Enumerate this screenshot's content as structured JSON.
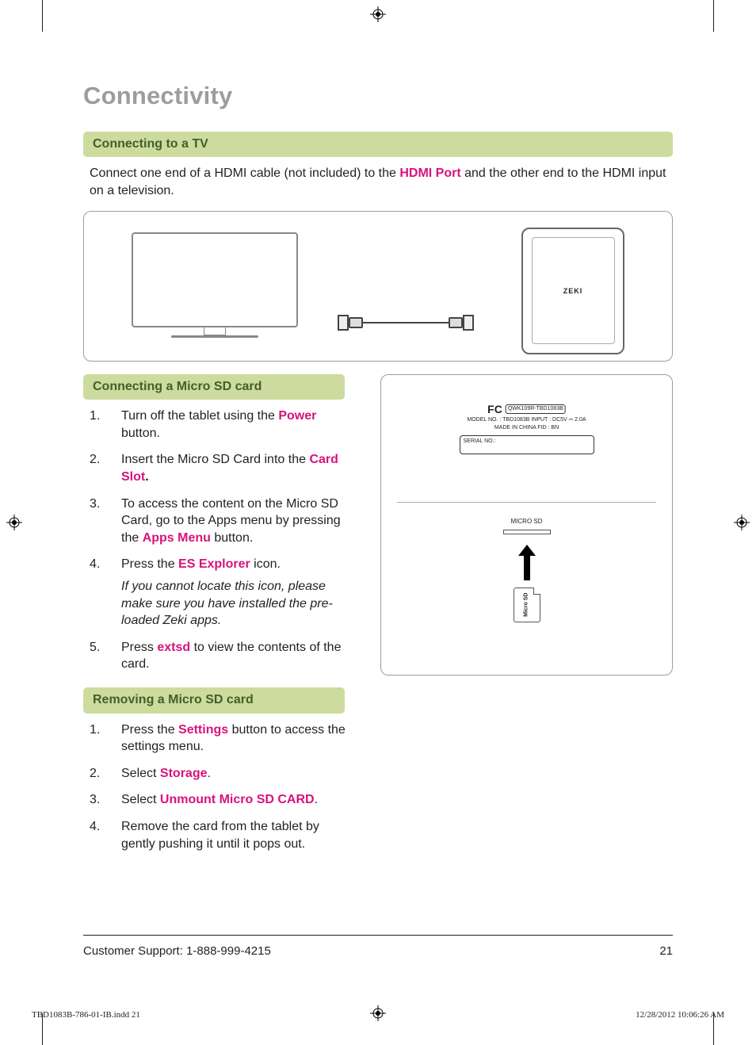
{
  "title": "Connectivity",
  "section_tv": {
    "heading": "Connecting to a TV",
    "text_pre": "Connect one end of a HDMI cable (not included) to the ",
    "hdmi_port": "HDMI Port",
    "text_post": " and the other end to the HDMI input on a television."
  },
  "diagram": {
    "zeki_brand": "ZEKI"
  },
  "section_sd": {
    "heading": "Connecting a Micro SD card",
    "steps": [
      {
        "num": "1.",
        "pre": "Turn off the tablet using the ",
        "hl": "Power",
        "post": " button."
      },
      {
        "num": "2.",
        "pre": "Insert the Micro SD Card into the ",
        "hl": "Card Slot",
        "post": "."
      },
      {
        "num": "3.",
        "pre": "To access the content on the Micro SD Card, go to the Apps menu by pressing the ",
        "hl": "Apps Menu",
        "post": " button."
      },
      {
        "num": "4.",
        "pre": "Press the ",
        "hl": "ES Explorer",
        "post": " icon.",
        "note": "If you cannot locate this icon, please make sure you have installed the pre-loaded Zeki apps."
      },
      {
        "num": "5.",
        "pre": "Press ",
        "hl": "extsd",
        "post": " to view the contents of the card."
      }
    ]
  },
  "section_remove": {
    "heading": "Removing a Micro SD card",
    "steps": [
      {
        "num": "1.",
        "pre": "Press the ",
        "hl": "Settings",
        "post": " button to access the settings menu."
      },
      {
        "num": "2.",
        "pre": "Select ",
        "hl": "Storage",
        "post": "."
      },
      {
        "num": "3.",
        "pre": "Select ",
        "hl": "Unmount Micro SD CARD",
        "post": "."
      },
      {
        "num": "4.",
        "pre": "Remove the card from the tablet by gently pushing it until it pops out.",
        "hl": "",
        "post": ""
      }
    ]
  },
  "right_panel": {
    "fcc_id": "QWK109R-TBD1083B",
    "model_line": "MODEL NO. : TBD1083B   INPUT : DC5V ⎓ 2.0A",
    "made_line": "MADE IN CHINA     FID : BN",
    "serial_label": "SERIAL NO.:",
    "microsd": "MICRO SD",
    "card_label": "Micro SD"
  },
  "footer": {
    "support": "Customer Support: 1-888-999-4215",
    "page_num": "21"
  },
  "imprint": {
    "file": "TBD1083B-786-01-IB.indd   21",
    "stamp": "12/28/2012   10:06:26 AM"
  }
}
